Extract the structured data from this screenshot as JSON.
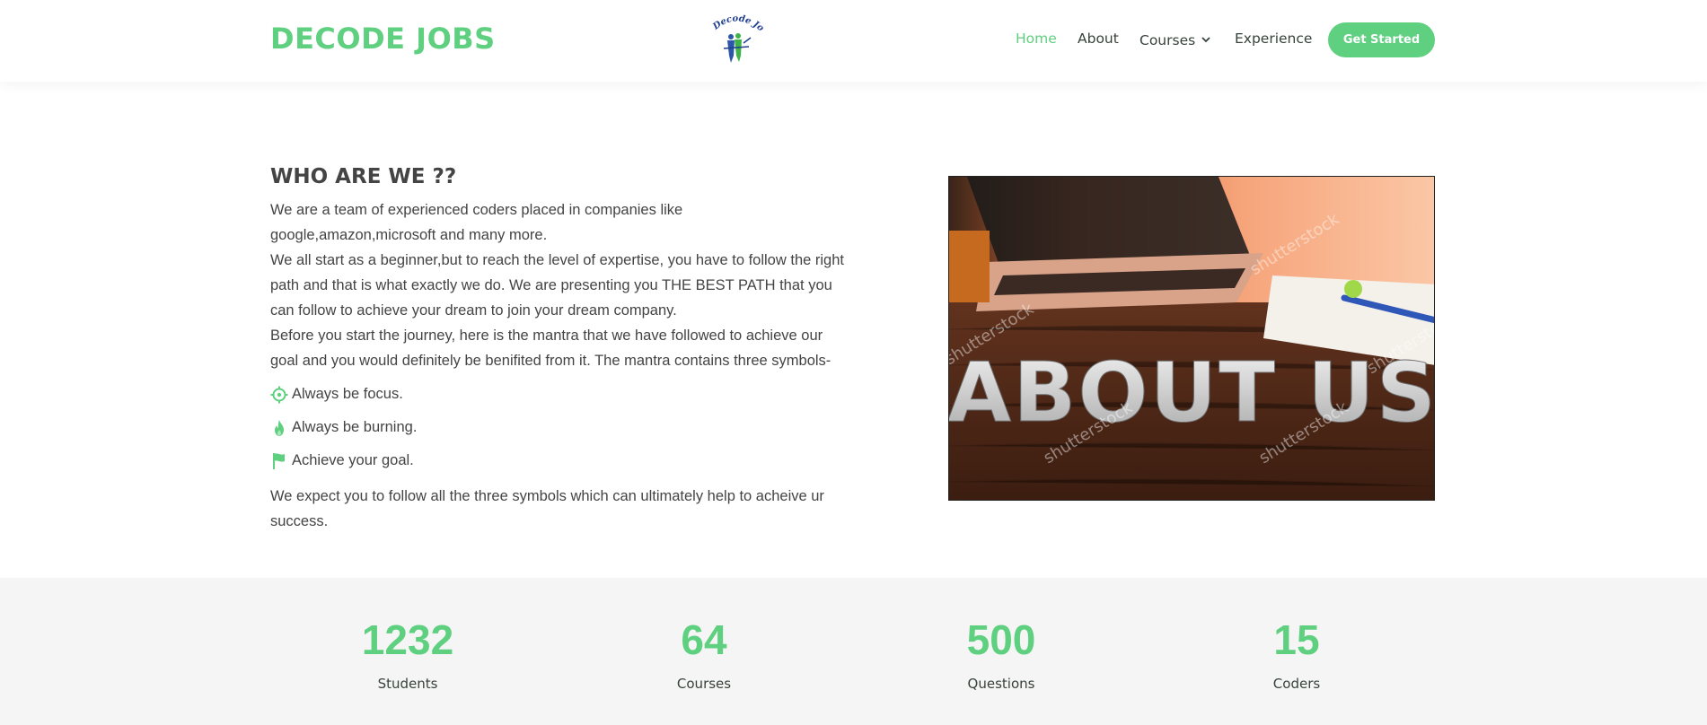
{
  "brand": "DECODE JOBS",
  "logo_text": "Decode Jobs",
  "nav": {
    "items": [
      {
        "label": "Home",
        "active": true
      },
      {
        "label": "About",
        "active": false
      },
      {
        "label": "Courses",
        "active": false,
        "dropdown": true
      },
      {
        "label": "Experience",
        "active": false
      }
    ],
    "cta": "Get Started"
  },
  "about": {
    "title": "WHO ARE WE ??",
    "paragraphs": [
      "We are a team of experienced coders placed in companies like google,amazon,microsoft and many more.",
      "We all start as a beginner,but to reach the level of expertise, you have to follow the right path and that is what exactly we do. We are presenting you THE BEST PATH that you can follow to achieve your dream to join your dream company.",
      "Before you start the journey, here is the mantra that we have followed to achieve our goal and you would definitely be benifited from it. The mantra contains three symbols-"
    ],
    "symbols": [
      {
        "icon": "target-icon",
        "label": "Always be focus."
      },
      {
        "icon": "flame-icon",
        "label": "Always be burning."
      },
      {
        "icon": "flag-icon",
        "label": "Achieve your goal."
      }
    ],
    "closing": "We expect you to follow all the three symbols which can ultimately help to acheive ur success.",
    "image_text": "ABOUT US",
    "image_watermark": "shutterstock"
  },
  "counts": [
    {
      "value": "1232",
      "label": "Students"
    },
    {
      "value": "64",
      "label": "Courses"
    },
    {
      "value": "500",
      "label": "Questions"
    },
    {
      "value": "15",
      "label": "Coders"
    }
  ],
  "colors": {
    "accent": "#5fcf80",
    "text": "#444444",
    "nav_text": "#37423b",
    "counts_bg": "#f5f5f5"
  }
}
